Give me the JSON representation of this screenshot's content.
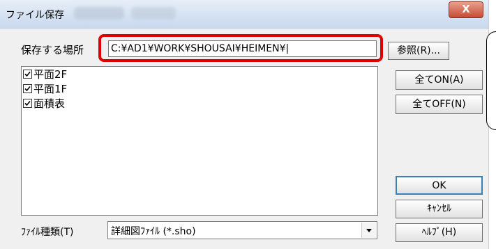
{
  "window": {
    "title": "ファイル保存",
    "close_label": "X"
  },
  "location": {
    "label": "保存する場所",
    "path_value": "C:¥AD1¥WORK¥SHOUSAI¥HEIMEN¥|",
    "browse_label": "参照(R)..."
  },
  "file_list": {
    "items": [
      {
        "label": "平面2F",
        "checked": true
      },
      {
        "label": "平面1F",
        "checked": true
      },
      {
        "label": "面積表",
        "checked": true
      }
    ]
  },
  "buttons": {
    "all_on": "全てON(A)",
    "all_off": "全てOFF(N)",
    "ok": "OK",
    "cancel": "ｷｬﾝｾﾙ",
    "help": "ﾍﾙﾌﾟ(H)"
  },
  "file_type": {
    "label": "ﾌｧｲﾙ種類(T)",
    "selected": "詳細図ﾌｧｲﾙ (*.sho)"
  },
  "colors": {
    "highlight": "#e00000",
    "close_button": "#c64c34"
  }
}
